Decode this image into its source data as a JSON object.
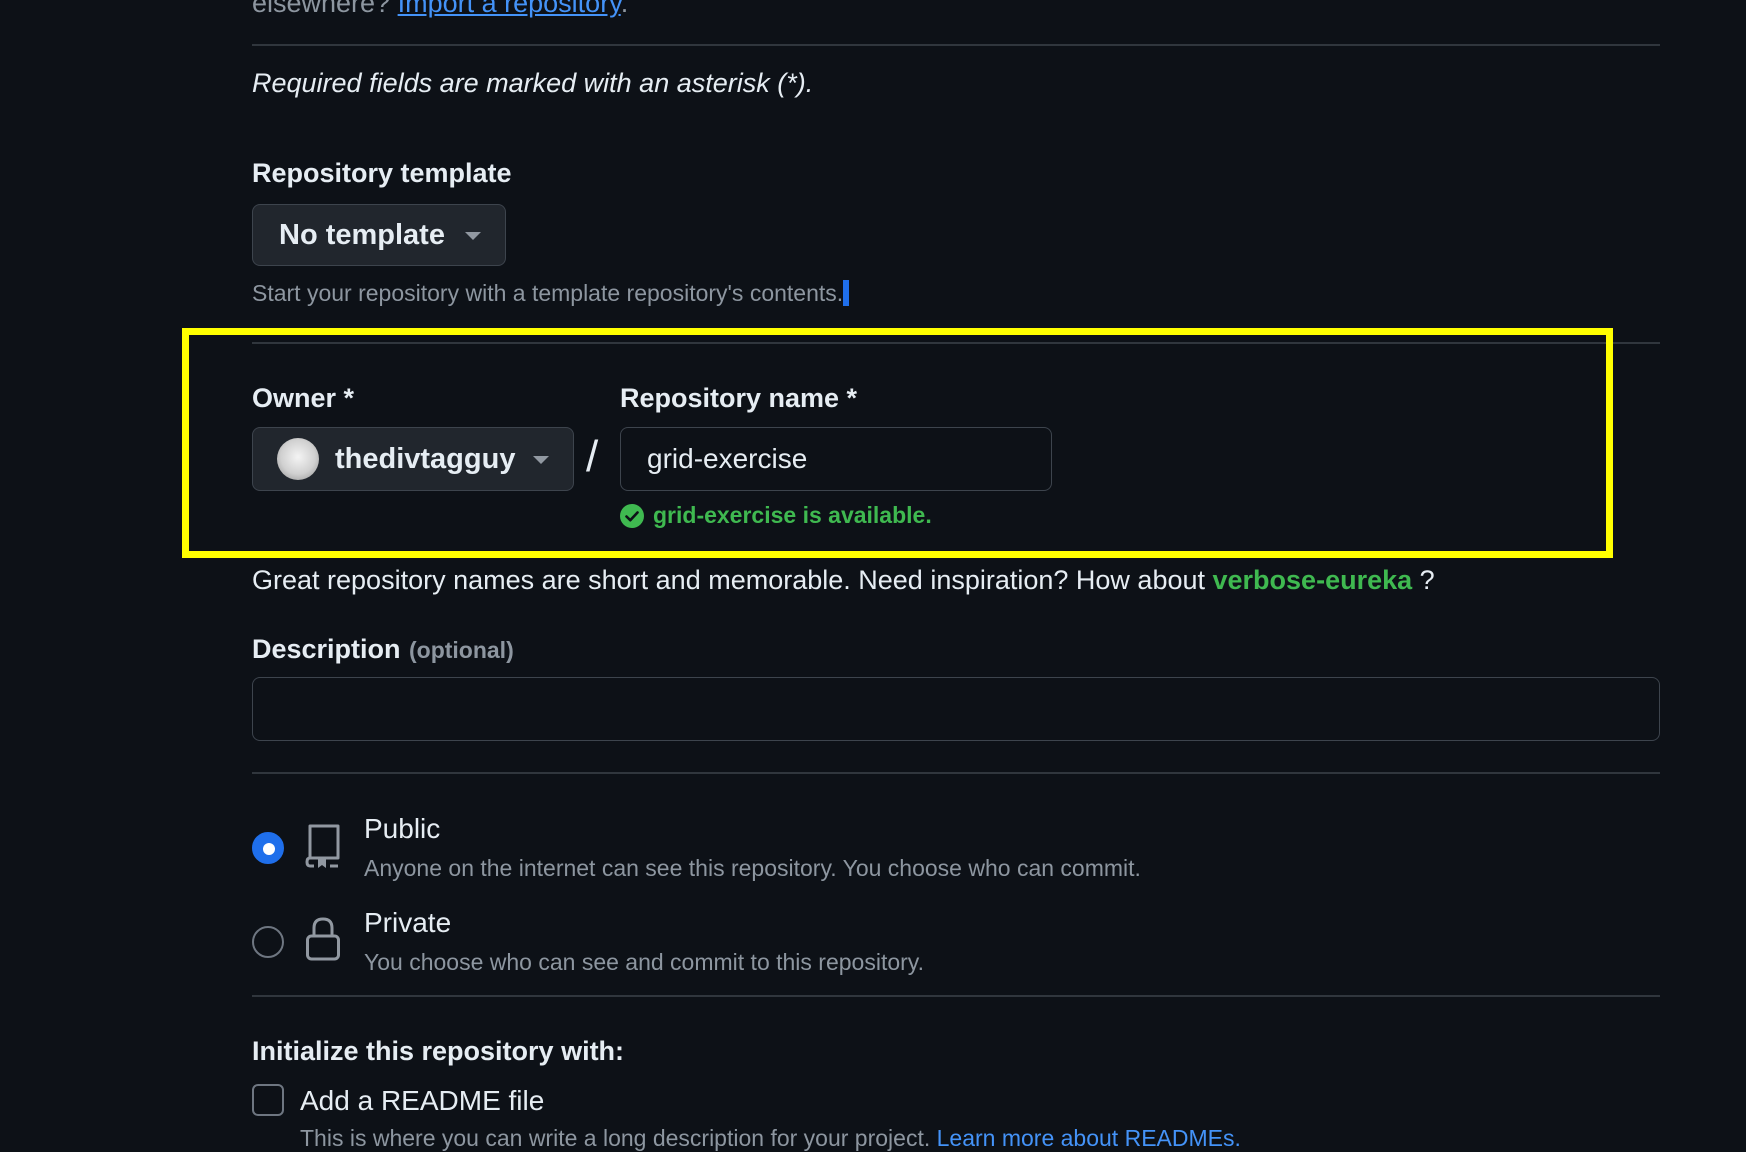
{
  "import": {
    "prefix": "elsewhere?",
    "link": "Import a repository",
    "suffix": "."
  },
  "required_note": "Required fields are marked with an asterisk (*).",
  "template": {
    "label": "Repository template",
    "selected": "No template",
    "help": "Start your repository with a template repository's contents."
  },
  "owner": {
    "label": "Owner *",
    "selected": "thedivtagguy"
  },
  "separator": "/",
  "repo_name": {
    "label": "Repository name *",
    "value": "grid-exercise",
    "availability": "grid-exercise is available."
  },
  "suggestion": {
    "text": "Great repository names are short and memorable. Need inspiration? How about",
    "name": "verbose-eureka",
    "suffix": "?"
  },
  "description": {
    "label": "Description",
    "optional": "(optional)",
    "value": ""
  },
  "visibility": [
    {
      "title": "Public",
      "description": "Anyone on the internet can see this repository. You choose who can commit.",
      "selected": true,
      "icon": "repo-icon"
    },
    {
      "title": "Private",
      "description": "You choose who can see and commit to this repository.",
      "selected": false,
      "icon": "lock-icon"
    }
  ],
  "initialize": {
    "heading": "Initialize this repository with:",
    "readme_label": "Add a README file",
    "readme_checked": false,
    "readme_desc": "This is where you can write a long description for your project.",
    "readme_link": "Learn more about READMEs."
  },
  "colors": {
    "background": "#0d1117",
    "highlight_box": "#ffff00",
    "accent_blue": "#1f6feb",
    "link_blue": "#4493f8",
    "success_green": "#3fb950"
  }
}
